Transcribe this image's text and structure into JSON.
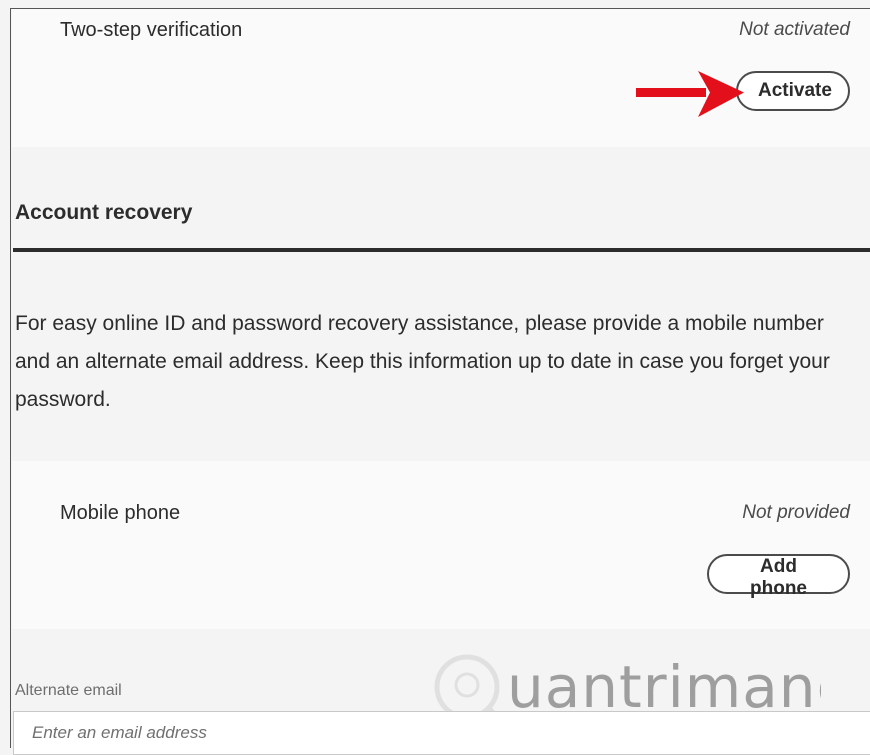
{
  "two_step": {
    "label": "Two-step verification",
    "status": "Not activated",
    "button": "Activate"
  },
  "account_recovery": {
    "title": "Account recovery",
    "description": "For easy online ID and password recovery assistance, please provide a mobile number and an alternate email address. Keep this information up to date in case you forget your password."
  },
  "mobile_phone": {
    "label": "Mobile phone",
    "status": "Not provided",
    "button": "Add phone"
  },
  "alternate_email": {
    "label": "Alternate email",
    "placeholder": "Enter an email address"
  },
  "watermark": {
    "text": "uantrimang"
  },
  "colors": {
    "arrow": "#e3101c",
    "card_bg": "#fafafa",
    "page_bg": "#f4f4f4"
  }
}
